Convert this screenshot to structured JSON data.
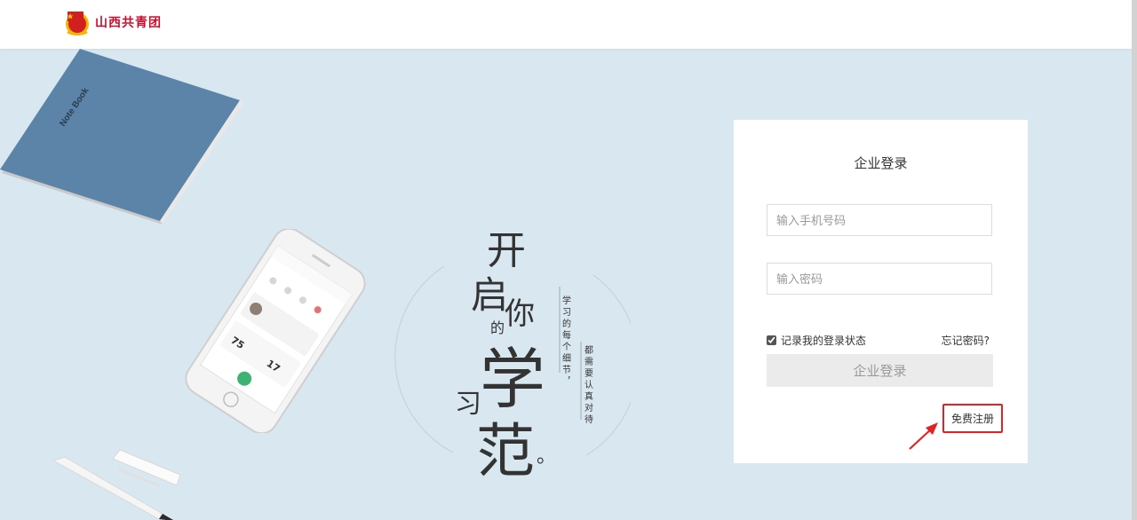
{
  "header": {
    "logo_text": "山西共青团",
    "logo_icon": "youth-league-emblem-icon"
  },
  "hero": {
    "notebook_label": "Note Book",
    "calligraphy": {
      "chars": [
        "开",
        "启",
        "你",
        "的",
        "学",
        "习",
        "范",
        "。"
      ],
      "column1": "学习的每个细节，",
      "column2": "都需要认真对待"
    }
  },
  "login": {
    "title": "企业登录",
    "phone_placeholder": "输入手机号码",
    "password_placeholder": "输入密码",
    "remember_label": "记录我的登录状态",
    "remember_checked": true,
    "forgot_label": "忘记密码?",
    "submit_label": "企业登录",
    "register_label": "免费注册"
  },
  "colors": {
    "background": "#d9e8f0",
    "highlight": "#e02424",
    "brand": "#c8102e"
  }
}
